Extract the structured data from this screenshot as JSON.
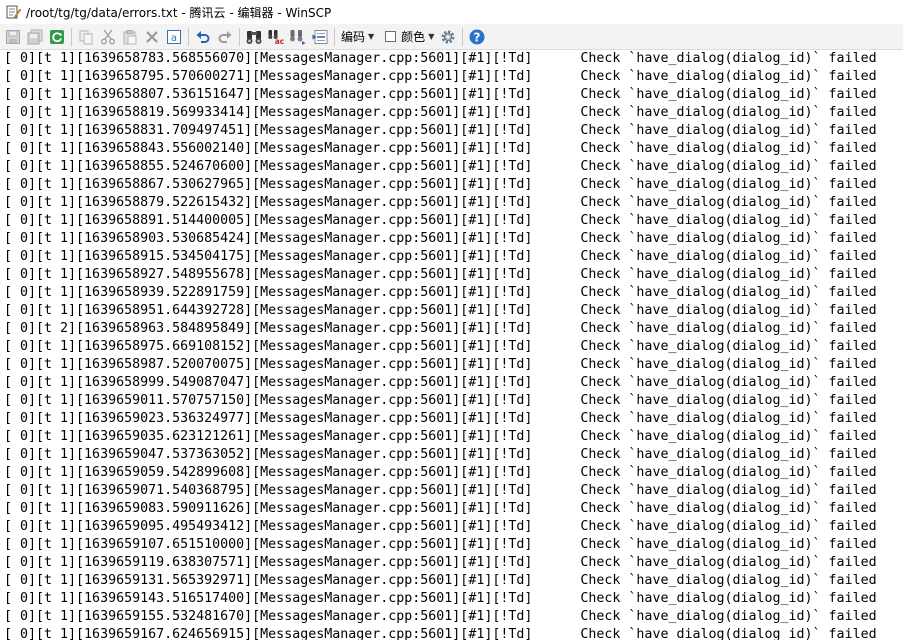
{
  "window": {
    "title": "/root/tg/tg/data/errors.txt - 腾讯云 - 编辑器 - WinSCP"
  },
  "toolbar": {
    "encoding_label": "编码",
    "color_label": "颜色",
    "color_checked": false,
    "icons": [
      "save-icon",
      "save-all-icon",
      "reload-icon",
      "copy-icon",
      "cut-icon",
      "paste-icon",
      "delete-icon",
      "select-all-icon",
      "undo-icon",
      "redo-icon",
      "find-icon",
      "replace-icon",
      "find-next-icon",
      "goto-line-icon",
      "settings-icon",
      "help-icon"
    ]
  },
  "editor": {
    "lines": [
      "[ 0][t 1][1639658783.568556070][MessagesManager.cpp:5601][#1][!Td]      Check `have_dialog(dialog_id)` failed",
      "[ 0][t 1][1639658795.570600271][MessagesManager.cpp:5601][#1][!Td]      Check `have_dialog(dialog_id)` failed",
      "[ 0][t 1][1639658807.536151647][MessagesManager.cpp:5601][#1][!Td]      Check `have_dialog(dialog_id)` failed",
      "[ 0][t 1][1639658819.569933414][MessagesManager.cpp:5601][#1][!Td]      Check `have_dialog(dialog_id)` failed",
      "[ 0][t 1][1639658831.709497451][MessagesManager.cpp:5601][#1][!Td]      Check `have_dialog(dialog_id)` failed",
      "[ 0][t 1][1639658843.556002140][MessagesManager.cpp:5601][#1][!Td]      Check `have_dialog(dialog_id)` failed",
      "[ 0][t 1][1639658855.524670600][MessagesManager.cpp:5601][#1][!Td]      Check `have_dialog(dialog_id)` failed",
      "[ 0][t 1][1639658867.530627965][MessagesManager.cpp:5601][#1][!Td]      Check `have_dialog(dialog_id)` failed",
      "[ 0][t 1][1639658879.522615432][MessagesManager.cpp:5601][#1][!Td]      Check `have_dialog(dialog_id)` failed",
      "[ 0][t 1][1639658891.514400005][MessagesManager.cpp:5601][#1][!Td]      Check `have_dialog(dialog_id)` failed",
      "[ 0][t 1][1639658903.530685424][MessagesManager.cpp:5601][#1][!Td]      Check `have_dialog(dialog_id)` failed",
      "[ 0][t 1][1639658915.534504175][MessagesManager.cpp:5601][#1][!Td]      Check `have_dialog(dialog_id)` failed",
      "[ 0][t 1][1639658927.548955678][MessagesManager.cpp:5601][#1][!Td]      Check `have_dialog(dialog_id)` failed",
      "[ 0][t 1][1639658939.522891759][MessagesManager.cpp:5601][#1][!Td]      Check `have_dialog(dialog_id)` failed",
      "[ 0][t 1][1639658951.644392728][MessagesManager.cpp:5601][#1][!Td]      Check `have_dialog(dialog_id)` failed",
      "[ 0][t 2][1639658963.584895849][MessagesManager.cpp:5601][#1][!Td]      Check `have_dialog(dialog_id)` failed",
      "[ 0][t 1][1639658975.669108152][MessagesManager.cpp:5601][#1][!Td]      Check `have_dialog(dialog_id)` failed",
      "[ 0][t 1][1639658987.520070075][MessagesManager.cpp:5601][#1][!Td]      Check `have_dialog(dialog_id)` failed",
      "[ 0][t 1][1639658999.549087047][MessagesManager.cpp:5601][#1][!Td]      Check `have_dialog(dialog_id)` failed",
      "[ 0][t 1][1639659011.570757150][MessagesManager.cpp:5601][#1][!Td]      Check `have_dialog(dialog_id)` failed",
      "[ 0][t 1][1639659023.536324977][MessagesManager.cpp:5601][#1][!Td]      Check `have_dialog(dialog_id)` failed",
      "[ 0][t 1][1639659035.623121261][MessagesManager.cpp:5601][#1][!Td]      Check `have_dialog(dialog_id)` failed",
      "[ 0][t 1][1639659047.537363052][MessagesManager.cpp:5601][#1][!Td]      Check `have_dialog(dialog_id)` failed",
      "[ 0][t 1][1639659059.542899608][MessagesManager.cpp:5601][#1][!Td]      Check `have_dialog(dialog_id)` failed",
      "[ 0][t 1][1639659071.540368795][MessagesManager.cpp:5601][#1][!Td]      Check `have_dialog(dialog_id)` failed",
      "[ 0][t 1][1639659083.590911626][MessagesManager.cpp:5601][#1][!Td]      Check `have_dialog(dialog_id)` failed",
      "[ 0][t 1][1639659095.495493412][MessagesManager.cpp:5601][#1][!Td]      Check `have_dialog(dialog_id)` failed",
      "[ 0][t 1][1639659107.651510000][MessagesManager.cpp:5601][#1][!Td]      Check `have_dialog(dialog_id)` failed",
      "[ 0][t 1][1639659119.638307571][MessagesManager.cpp:5601][#1][!Td]      Check `have_dialog(dialog_id)` failed",
      "[ 0][t 1][1639659131.565392971][MessagesManager.cpp:5601][#1][!Td]      Check `have_dialog(dialog_id)` failed",
      "[ 0][t 1][1639659143.516517400][MessagesManager.cpp:5601][#1][!Td]      Check `have_dialog(dialog_id)` failed",
      "[ 0][t 1][1639659155.532481670][MessagesManager.cpp:5601][#1][!Td]      Check `have_dialog(dialog_id)` failed",
      "[ 0][t 1][1639659167.624656915][MessagesManager.cpp:5601][#1][!Td]      Check `have_dialog(dialog_id)` failed"
    ]
  }
}
